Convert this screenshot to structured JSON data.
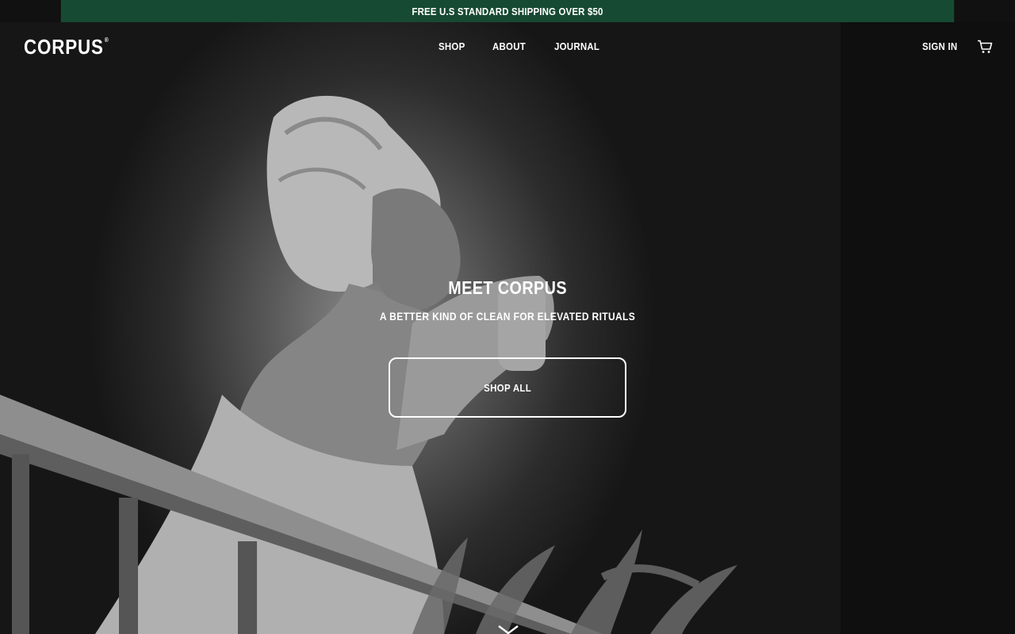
{
  "announcement": {
    "text": "FREE U.S STANDARD SHIPPING OVER $50"
  },
  "header": {
    "logo": "CORPUS",
    "logo_mark": "®",
    "nav": [
      {
        "label": "SHOP"
      },
      {
        "label": "ABOUT"
      },
      {
        "label": "JOURNAL"
      }
    ],
    "sign_in": "SIGN IN",
    "cart_icon": "cart-icon"
  },
  "hero": {
    "title": "MEET CORPUS",
    "subtitle": "A BETTER KIND OF CLEAN FOR ELEVATED RITUALS",
    "cta": "SHOP ALL",
    "scroll_icon": "chevron-down-icon"
  },
  "colors": {
    "announcement_bg": "#174a32",
    "text": "#ffffff"
  }
}
